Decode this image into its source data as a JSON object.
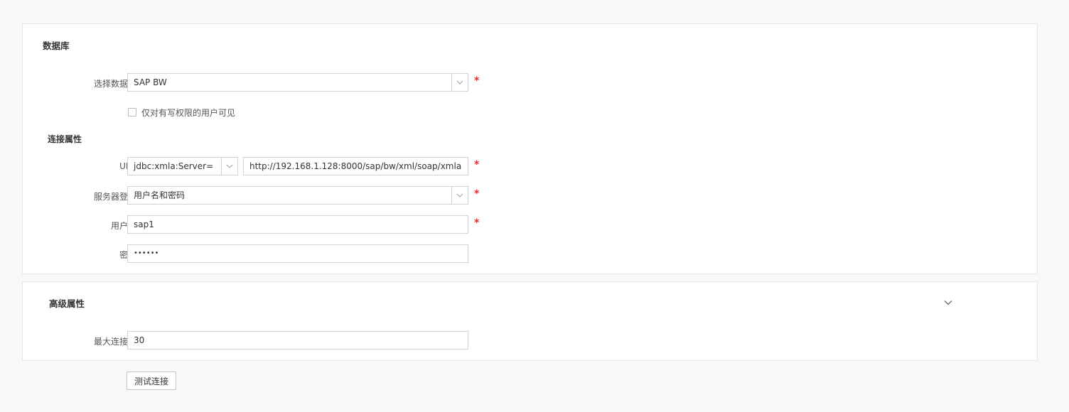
{
  "database_section": {
    "title": "数据库",
    "datasource_label": "选择数据源:",
    "datasource_value": "SAP BW",
    "checkbox_label": "仅对有写权限的用户可见",
    "connection_title": "连接属性",
    "url_label": "URL:",
    "url_prefix_value": "jdbc:xmla:Server=",
    "url_value": "http://192.168.1.128:8000/sap/bw/xml/soap/xmla",
    "server_login_label": "服务器登录:",
    "server_login_value": "用户名和密码",
    "username_label": "用户名:",
    "username_value": "sap1",
    "password_label": "密码:",
    "password_value": "••••••",
    "required_mark": "*"
  },
  "advanced_section": {
    "title": "高级属性",
    "max_connections_label": "最大连接数:",
    "max_connections_value": "30"
  },
  "test_button_label": "测试连接",
  "icons": {
    "select_arrow": "chevron-down-icon",
    "collapse_toggle": "chevron-down-icon"
  },
  "colors": {
    "required": "#e02e2e",
    "border": "#cfd2d6",
    "background": "#f7f8fa"
  }
}
